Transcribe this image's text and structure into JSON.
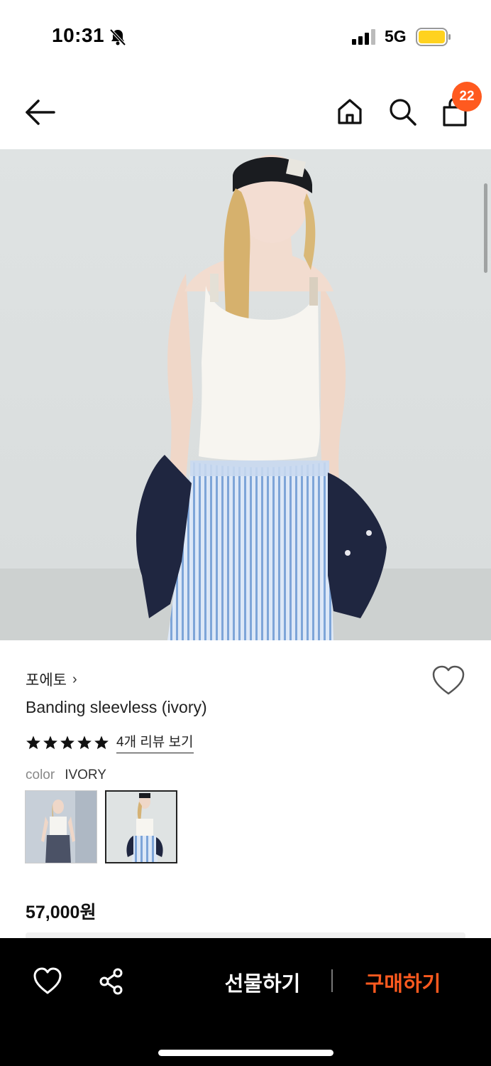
{
  "status_bar": {
    "time": "10:31",
    "network": "5G",
    "battery_color": "#ffd21f"
  },
  "header": {
    "back_icon": "arrow-left-icon",
    "home_icon": "home-icon",
    "search_icon": "search-icon",
    "bag_icon": "shopping-bag-icon",
    "cart_count": "22",
    "badge_color": "#ff5a1f"
  },
  "product": {
    "brand": "포에토",
    "brand_chevron": "›",
    "title": "Banding sleevless (ivory)",
    "rating_stars": 5,
    "review_link": "4개 리뷰 보기",
    "color_label": "color",
    "color_value": "IVORY",
    "price": "57,000원"
  },
  "bottom_bar": {
    "wish_icon": "heart-icon",
    "share_icon": "share-icon",
    "gift_label": "선물하기",
    "buy_label": "구매하기",
    "buy_color": "#ff5a1f"
  }
}
